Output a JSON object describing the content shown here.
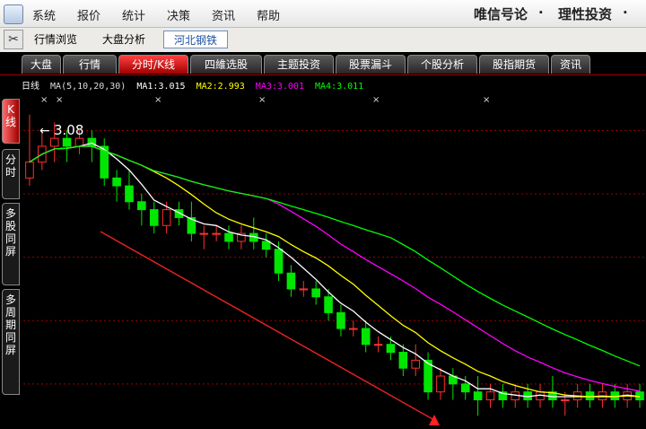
{
  "menubar": {
    "items": [
      "系统",
      "报价",
      "统计",
      "决策",
      "资讯",
      "帮助"
    ],
    "slogan_left": "唯信号论",
    "slogan_sep": "·",
    "slogan_right": "理性投资",
    "slogan_tail": "·"
  },
  "top_tabs": [
    "行情浏览",
    "大盘分析",
    "河北钢铁"
  ],
  "function_tabs": [
    "大盘",
    "行情",
    "分时/K线",
    "四維选股",
    "主题投资",
    "股票漏斗",
    "个股分析",
    "股指期货",
    "资讯"
  ],
  "side_tabs": [
    "K线",
    "分时",
    "多股同屏",
    "多周期同屏"
  ],
  "indicator": {
    "period": "日线",
    "ma_label": "MA(5,10,20,30)",
    "ma1": "MA1:3.015",
    "ma2": "MA2:2.993",
    "ma3": "MA3:3.001",
    "ma4": "MA4:3.011",
    "colors": {
      "ma1": "#ffffff",
      "ma2": "#ffff00",
      "ma3": "#ff00ff",
      "ma4": "#00ff00",
      "up": "#ff3030",
      "down": "#00e600",
      "grid": "#a00000",
      "trendline": "#dd2222"
    }
  },
  "price_annotation": "3.08",
  "bottom_marker": "×",
  "icons": {
    "app": "app-logo-icon",
    "tool": "scissors-icon",
    "arrow": "left-arrow-icon",
    "signal": "cross-signal-icon"
  },
  "chart_data": {
    "type": "candlestick",
    "candles": [
      [
        3.0,
        3.02,
        3.08,
        2.99
      ],
      [
        3.02,
        3.04,
        3.06,
        3.01
      ],
      [
        3.04,
        3.05,
        3.07,
        3.02
      ],
      [
        3.05,
        3.04,
        3.06,
        3.02
      ],
      [
        3.04,
        3.05,
        3.06,
        3.03
      ],
      [
        3.05,
        3.04,
        3.06,
        3.02
      ],
      [
        3.04,
        3.0,
        3.05,
        2.99
      ],
      [
        3.0,
        2.99,
        3.01,
        2.97
      ],
      [
        2.99,
        2.97,
        3.01,
        2.96
      ],
      [
        2.97,
        2.96,
        2.98,
        2.94
      ],
      [
        2.96,
        2.94,
        2.97,
        2.93
      ],
      [
        2.94,
        2.96,
        2.97,
        2.93
      ],
      [
        2.96,
        2.95,
        2.97,
        2.94
      ],
      [
        2.95,
        2.93,
        2.97,
        2.92
      ],
      [
        2.93,
        2.93,
        2.94,
        2.91
      ],
      [
        2.93,
        2.93,
        2.94,
        2.92
      ],
      [
        2.93,
        2.92,
        2.94,
        2.91
      ],
      [
        2.92,
        2.93,
        2.94,
        2.91
      ],
      [
        2.93,
        2.92,
        2.95,
        2.91
      ],
      [
        2.92,
        2.91,
        2.93,
        2.9
      ],
      [
        2.91,
        2.88,
        2.92,
        2.87
      ],
      [
        2.88,
        2.86,
        2.89,
        2.85
      ],
      [
        2.86,
        2.86,
        2.87,
        2.85
      ],
      [
        2.86,
        2.85,
        2.87,
        2.84
      ],
      [
        2.85,
        2.83,
        2.86,
        2.82
      ],
      [
        2.83,
        2.81,
        2.84,
        2.8
      ],
      [
        2.81,
        2.81,
        2.82,
        2.8
      ],
      [
        2.81,
        2.79,
        2.82,
        2.78
      ],
      [
        2.79,
        2.79,
        2.8,
        2.78
      ],
      [
        2.79,
        2.78,
        2.8,
        2.77
      ],
      [
        2.78,
        2.76,
        2.79,
        2.75
      ],
      [
        2.76,
        2.77,
        2.79,
        2.75
      ],
      [
        2.77,
        2.73,
        2.78,
        2.72
      ],
      [
        2.73,
        2.75,
        2.76,
        2.72
      ],
      [
        2.75,
        2.74,
        2.76,
        2.72
      ],
      [
        2.74,
        2.73,
        2.75,
        2.72
      ],
      [
        2.73,
        2.72,
        2.75,
        2.7
      ],
      [
        2.72,
        2.73,
        2.74,
        2.71
      ],
      [
        2.73,
        2.72,
        2.74,
        2.71
      ],
      [
        2.72,
        2.73,
        2.74,
        2.71
      ],
      [
        2.73,
        2.72,
        2.74,
        2.71
      ],
      [
        2.72,
        2.73,
        2.74,
        2.71
      ],
      [
        2.73,
        2.72,
        2.75,
        2.71
      ],
      [
        2.72,
        2.72,
        2.73,
        2.7
      ],
      [
        2.72,
        2.73,
        2.74,
        2.71
      ],
      [
        2.73,
        2.72,
        2.74,
        2.71
      ],
      [
        2.72,
        2.73,
        2.74,
        2.71
      ],
      [
        2.73,
        2.72,
        2.74,
        2.71
      ],
      [
        2.72,
        2.73,
        2.74,
        2.71
      ],
      [
        2.73,
        2.72,
        2.74,
        2.71
      ]
    ],
    "ylim": [
      2.69,
      3.1
    ]
  }
}
